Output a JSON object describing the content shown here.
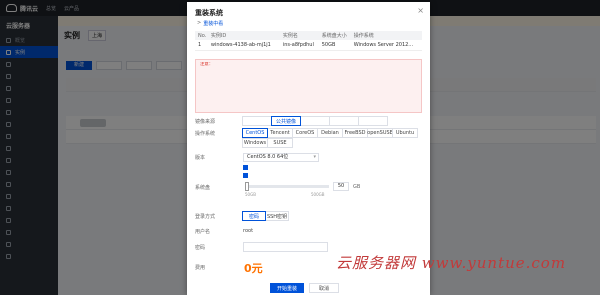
{
  "app": {
    "logo": "腾讯云",
    "nav": [
      "总览",
      "云产品"
    ],
    "top_right": [
      "",
      "",
      "",
      ""
    ]
  },
  "sidebar": {
    "title": "云服务器",
    "items": [
      {
        "label": "概览",
        "active": false
      },
      {
        "label": "实例",
        "active": true
      },
      {
        "label": "",
        "active": false
      },
      {
        "label": "",
        "active": false
      },
      {
        "label": "",
        "active": false
      },
      {
        "label": "",
        "active": false
      },
      {
        "label": "",
        "active": false
      },
      {
        "label": "",
        "active": false
      },
      {
        "label": "",
        "active": false
      },
      {
        "label": "",
        "active": false
      },
      {
        "label": "",
        "active": false
      },
      {
        "label": "",
        "active": false
      },
      {
        "label": "",
        "active": false
      },
      {
        "label": "",
        "active": false
      },
      {
        "label": "",
        "active": false
      },
      {
        "label": "",
        "active": false
      },
      {
        "label": "",
        "active": false
      },
      {
        "label": "",
        "active": false
      },
      {
        "label": "",
        "active": false
      }
    ]
  },
  "main": {
    "notice": "",
    "page_title": "实例",
    "region": "上海",
    "create_label": "新建",
    "row_link": ""
  },
  "modal": {
    "title": "重装系统",
    "steps": [
      {
        "label": "",
        "current": false
      },
      {
        "label": ">",
        "current": false
      },
      {
        "label": "重装中看",
        "current": true
      }
    ],
    "table": {
      "headers": [
        "No.",
        "实例ID",
        "实例名",
        "系统盘大小",
        "操作系统"
      ],
      "rows": [
        [
          "1",
          "windows-4138-ab-mj1j1",
          "ins-a8fpdhul",
          "50GB",
          "Windows Server 2012..."
        ]
      ]
    },
    "warning_lines": [
      "注意：",
      "",
      "",
      "",
      "",
      "",
      "",
      ""
    ],
    "image_type": {
      "label": "镜像来源",
      "options": [
        {
          "label": "",
          "on": false
        },
        {
          "label": "公共镜像",
          "on": true
        },
        {
          "label": "",
          "on": false
        },
        {
          "label": "",
          "on": false
        },
        {
          "label": "",
          "on": false
        }
      ]
    },
    "os": {
      "label": "操作系统",
      "options": [
        {
          "label": "CentOS",
          "on": true
        },
        {
          "label": "Tencent",
          "on": false
        },
        {
          "label": "CoreOS",
          "on": false
        },
        {
          "label": "Debian",
          "on": false
        },
        {
          "label": "FreeBSD",
          "on": false
        },
        {
          "label": "openSUSE",
          "on": false
        },
        {
          "label": "Ubuntu",
          "on": false
        },
        {
          "label": "Windows",
          "on": false
        },
        {
          "label": "SUSE",
          "on": false
        }
      ]
    },
    "version": {
      "label": "版本",
      "value": "CentOS 8.0 64位"
    },
    "checkbox_1": "",
    "checkbox_2": "",
    "disk": {
      "label": "系统盘",
      "fill_fraction": 0.02,
      "min": "50GB",
      "max": "500GB",
      "value": "50",
      "unit": "GB",
      "link": ""
    },
    "login": {
      "label": "登录方式",
      "options": [
        {
          "label": "密码",
          "on": true
        },
        {
          "label": "SSH密钥",
          "on": false
        }
      ]
    },
    "username": {
      "label": "用户名",
      "value": "root"
    },
    "password": {
      "label": "密码",
      "value": "",
      "hint": ""
    },
    "price": {
      "label": "费用",
      "value": "0元"
    },
    "ok": "开始重装",
    "cancel": "取消"
  },
  "watermark": "云服务器网 www.yuntue.com"
}
